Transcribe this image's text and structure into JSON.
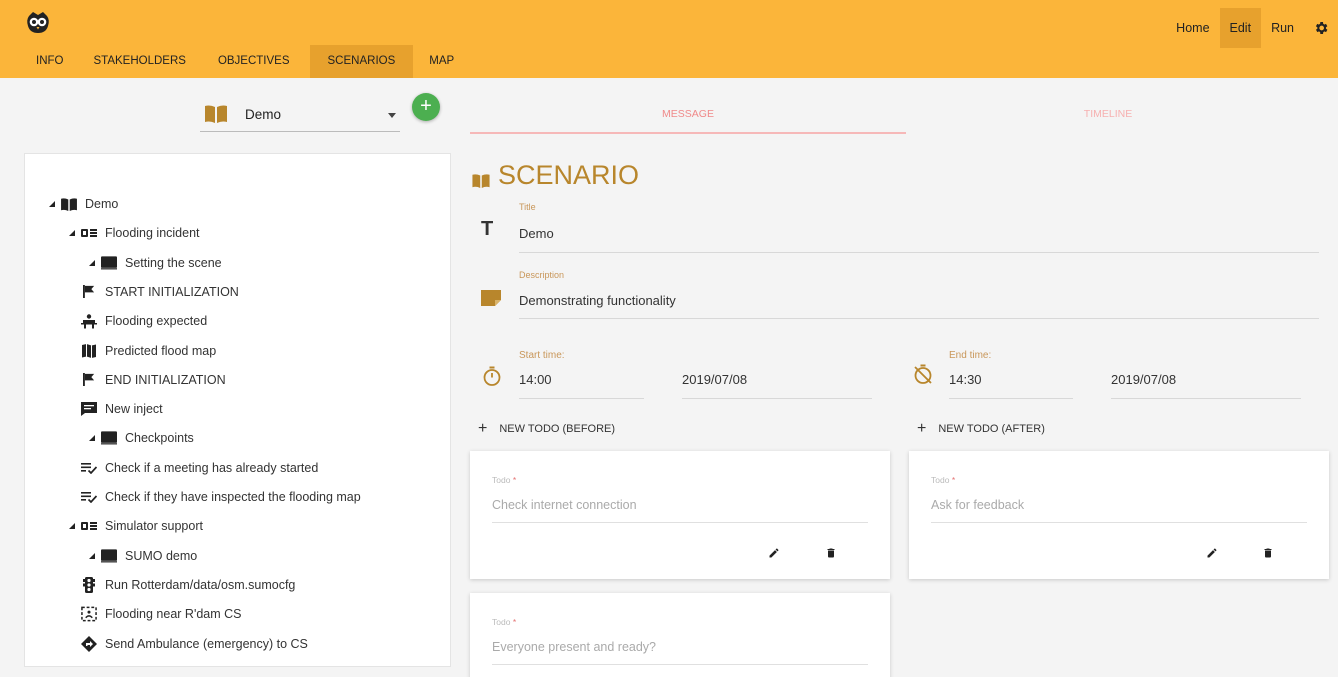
{
  "header": {
    "nav": {
      "home": "Home",
      "edit": "Edit",
      "run": "Run"
    },
    "tabs": [
      "INFO",
      "STAKEHOLDERS",
      "OBJECTIVES",
      "SCENARIOS",
      "MAP"
    ],
    "active_tab": "SCENARIOS",
    "accent_color": "#fbb53a"
  },
  "scenario_select": {
    "value": "Demo"
  },
  "tree": {
    "items": [
      {
        "label": "Demo",
        "icon": "book-icon",
        "level": 0,
        "expandable": true
      },
      {
        "label": "Flooding incident",
        "icon": "storyline-icon",
        "level": 1,
        "expandable": true
      },
      {
        "label": "Setting the scene",
        "icon": "act-icon",
        "level": 2,
        "expandable": true
      },
      {
        "label": "START INITIALIZATION",
        "icon": "flag-icon",
        "level": 3,
        "expandable": false
      },
      {
        "label": "Flooding expected",
        "icon": "person-role-icon",
        "level": 3,
        "expandable": false
      },
      {
        "label": "Predicted flood map",
        "icon": "map-icon",
        "level": 3,
        "expandable": false
      },
      {
        "label": "END INITIALIZATION",
        "icon": "flag-icon",
        "level": 3,
        "expandable": false
      },
      {
        "label": "New inject",
        "icon": "message-icon",
        "level": 3,
        "expandable": false
      },
      {
        "label": "Checkpoints",
        "icon": "act-icon",
        "level": 2,
        "expandable": true
      },
      {
        "label": "Check if a meeting has already started",
        "icon": "checklist-icon",
        "level": 3,
        "expandable": false
      },
      {
        "label": "Check if they have inspected the flooding map",
        "icon": "checklist-icon",
        "level": 3,
        "expandable": false
      },
      {
        "label": "Simulator support",
        "icon": "storyline-icon",
        "level": 1,
        "expandable": true
      },
      {
        "label": "SUMO demo",
        "icon": "act-icon",
        "level": 2,
        "expandable": true
      },
      {
        "label": "Run Rotterdam/data/osm.sumocfg",
        "icon": "traffic-light-icon",
        "level": 3,
        "expandable": false
      },
      {
        "label": "Flooding near R'dam CS",
        "icon": "area-icon",
        "level": 3,
        "expandable": false
      },
      {
        "label": "Send Ambulance (emergency) to CS",
        "icon": "direction-icon",
        "level": 3,
        "expandable": false
      }
    ]
  },
  "content_tabs": [
    "MESSAGE",
    "TIMELINE"
  ],
  "scenario": {
    "heading": "SCENARIO",
    "title_label": "Title",
    "title_value": "Demo",
    "description_label": "Description",
    "description_value": "Demonstrating functionality",
    "start_label": "Start time:",
    "start_time": "14:00",
    "start_date": "2019/07/08",
    "end_label": "End time:",
    "end_time": "14:30",
    "end_date": "2019/07/08"
  },
  "todos": {
    "new_before": "NEW TODO (BEFORE)",
    "new_after": "NEW TODO (AFTER)",
    "label": "Todo",
    "required_mark": "*",
    "before": [
      "Check internet connection",
      "Everyone present and ready?"
    ],
    "after": [
      "Ask for feedback"
    ]
  }
}
